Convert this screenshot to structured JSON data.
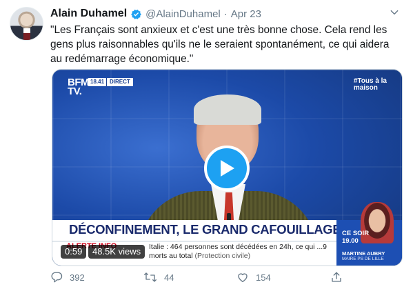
{
  "tweet": {
    "display_name": "Alain Duhamel",
    "handle": "@AlainDuhamel",
    "separator": "·",
    "date": "Apr 23",
    "text": "\"Les Français sont anxieux et c'est une très bonne chose. Cela rend les gens plus raisonnables qu'ils ne le seraient spontanément, ce qui aidera au redémarrage économique.\""
  },
  "video": {
    "channel_logo_line1": "BFM",
    "channel_logo_line2": "TV.",
    "live_time": "18.41",
    "live_label": "DIRECT",
    "corner_tag_line1": "#Tous à la",
    "corner_tag_line2": "maison",
    "banner": "DÉCONFINEMENT, LE GRAND CAFOUILLAGE ?",
    "ticker_label": "ALERTE INFO",
    "ticker_text": "Italie : 464 personnes sont décédées en 24h, ce qui ...9 morts au total",
    "ticker_source": "(Protection civile)",
    "side_when_line1": "CE SOIR",
    "side_when_line2": "19.00",
    "side_name": "MARTINE AUBRY",
    "side_role": "MAIRE PS DE LILLE",
    "duration": "0:59",
    "views": "48.5K views",
    "accent_color": "#1da1f2"
  },
  "actions": {
    "replies": "392",
    "retweets": "44",
    "likes": "154"
  },
  "icons": [
    "verified-icon",
    "chevron-down-icon",
    "play-icon",
    "reply-icon",
    "retweet-icon",
    "like-icon",
    "share-icon"
  ]
}
